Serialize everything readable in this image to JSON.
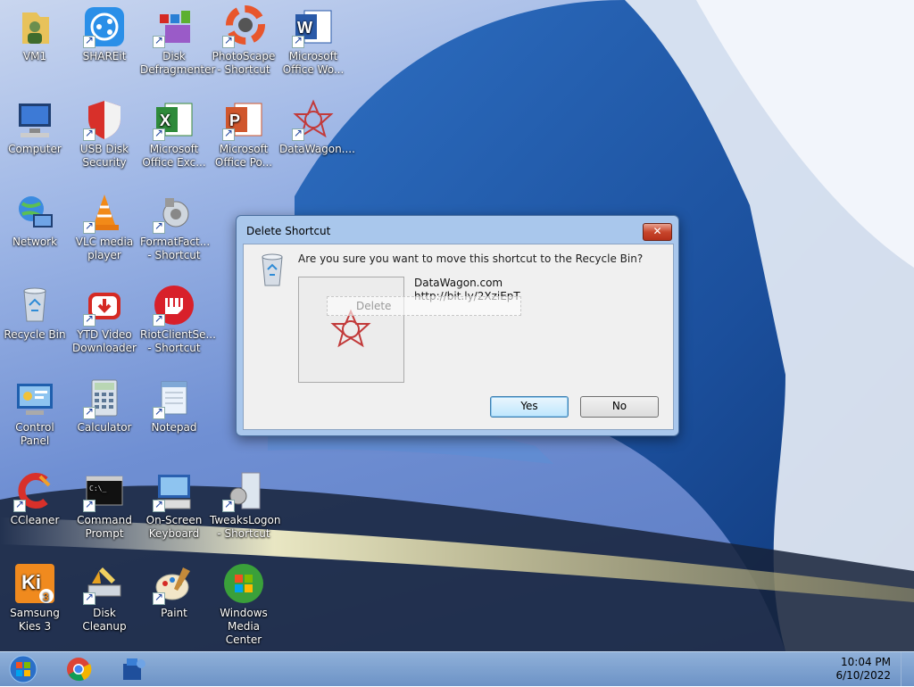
{
  "desktop": {
    "icons": [
      {
        "label": "VM1"
      },
      {
        "label": "SHAREit"
      },
      {
        "label": "Disk Defragmenter"
      },
      {
        "label": "PhotoScape - Shortcut"
      },
      {
        "label": "Microsoft Office Wo..."
      },
      {
        "label": "Computer"
      },
      {
        "label": "USB Disk Security"
      },
      {
        "label": "Microsoft Office Exc..."
      },
      {
        "label": "Microsoft Office Po..."
      },
      {
        "label": "DataWagon...."
      },
      {
        "label": "Network"
      },
      {
        "label": "VLC media player"
      },
      {
        "label": "FormatFact... - Shortcut"
      },
      {
        "label": "Recycle Bin"
      },
      {
        "label": "YTD Video Downloader"
      },
      {
        "label": "RiotClientSe... - Shortcut"
      },
      {
        "label": "Control Panel"
      },
      {
        "label": "Calculator"
      },
      {
        "label": "Notepad"
      },
      {
        "label": "CCleaner"
      },
      {
        "label": "Command Prompt"
      },
      {
        "label": "On-Screen Keyboard"
      },
      {
        "label": "TweaksLogon - Shortcut"
      },
      {
        "label": "Samsung Kies 3"
      },
      {
        "label": "Disk Cleanup"
      },
      {
        "label": "Paint"
      },
      {
        "label": "Windows Media Center"
      }
    ]
  },
  "dialog": {
    "title": "Delete Shortcut",
    "close_label": "✕",
    "message": "Are you sure you want to move this shortcut to the Recycle Bin?",
    "item_name": "DataWagon.com",
    "item_url": "http://bit.ly/2XziEpT",
    "drag_label": "Delete",
    "yes_label": "Yes",
    "no_label": "No"
  },
  "taskbar": {
    "apps": [
      "start-orb",
      "chrome",
      "network-app"
    ],
    "time": "10:04 PM",
    "date": "6/10/2022"
  },
  "colors": {
    "taskbar": "#7a9fd0",
    "dialog_frame": "#a9c7ec",
    "close_button": "#c8462c"
  }
}
